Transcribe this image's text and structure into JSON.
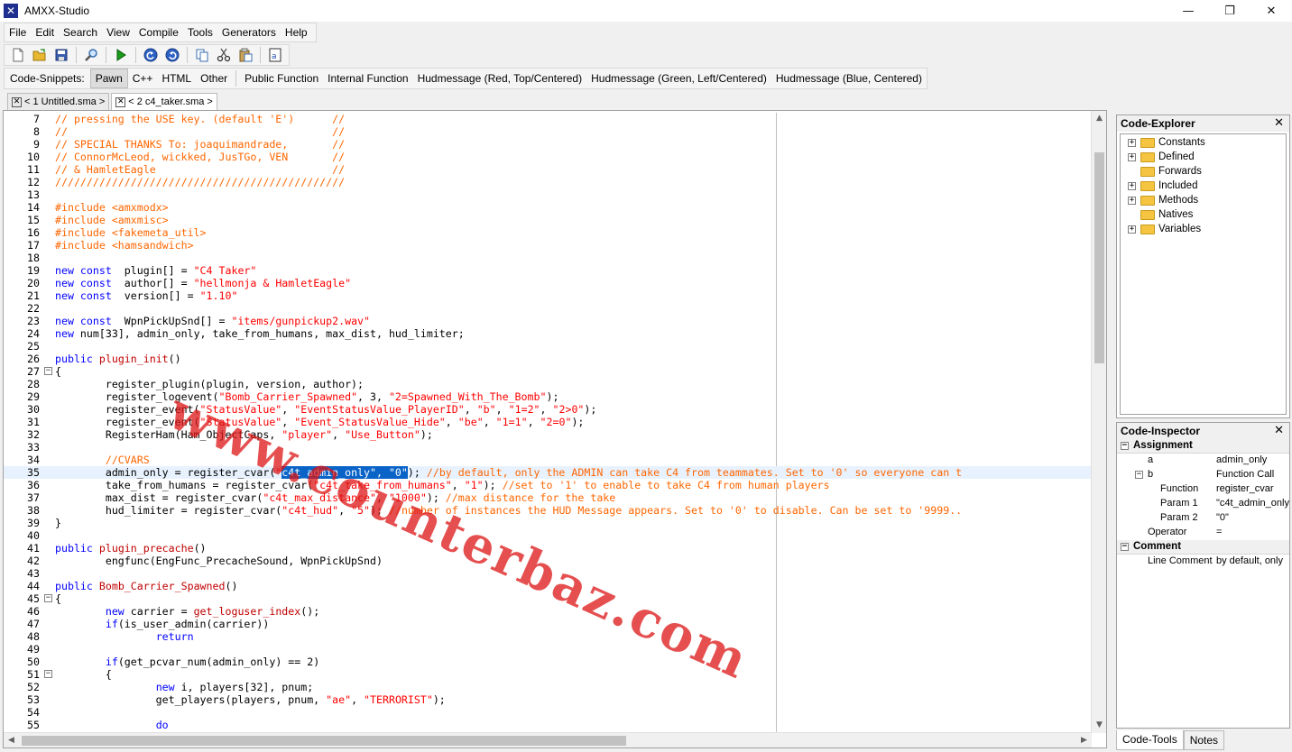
{
  "window": {
    "title": "AMXX-Studio"
  },
  "menu": [
    "File",
    "Edit",
    "Search",
    "View",
    "Compile",
    "Tools",
    "Generators",
    "Help"
  ],
  "toolbar_icons": [
    "new-file-icon",
    "open-folder-icon",
    "save-icon",
    "search-icon",
    "compile-run-icon",
    "undo-icon",
    "redo-icon",
    "copy-icon",
    "cut-icon",
    "paste-icon",
    "select-all-icon"
  ],
  "snippets": {
    "label": "Code-Snippets:",
    "items": [
      "Pawn",
      "C++",
      "HTML",
      "Other",
      "Public Function",
      "Internal Function",
      "Hudmessage (Red, Top/Centered)",
      "Hudmessage (Green, Left/Centered)",
      "Hudmessage (Blue, Centered)"
    ],
    "active": "Pawn"
  },
  "tabs": [
    {
      "label": "< 1 Untitled.sma >",
      "active": false
    },
    {
      "label": "< 2 c4_taker.sma >",
      "active": true
    }
  ],
  "watermark": "www.counterbaz.com",
  "code_lines": [
    {
      "n": "7",
      "fold": "",
      "tokens": [
        [
          "cm",
          "// pressing the USE key. (default 'E')      //"
        ]
      ]
    },
    {
      "n": "8",
      "fold": "",
      "tokens": [
        [
          "cm",
          "//                                          //"
        ]
      ]
    },
    {
      "n": "9",
      "fold": "",
      "tokens": [
        [
          "cm",
          "// SPECIAL THANKS To: joaquimandrade,       //"
        ]
      ]
    },
    {
      "n": "10",
      "fold": "",
      "tokens": [
        [
          "cm",
          "// ConnorMcLeod, wickked, JusTGo, VEN       //"
        ]
      ]
    },
    {
      "n": "11",
      "fold": "",
      "tokens": [
        [
          "cm",
          "// & HamletEagle                            //"
        ]
      ]
    },
    {
      "n": "12",
      "fold": "",
      "tokens": [
        [
          "cm",
          "//////////////////////////////////////////////"
        ]
      ]
    },
    {
      "n": "13",
      "fold": "",
      "tokens": []
    },
    {
      "n": "14",
      "fold": "",
      "tokens": [
        [
          "pp",
          "#include <amxmodx>"
        ]
      ]
    },
    {
      "n": "15",
      "fold": "",
      "tokens": [
        [
          "pp",
          "#include <amxmisc>"
        ]
      ]
    },
    {
      "n": "16",
      "fold": "",
      "tokens": [
        [
          "pp",
          "#include <fakemeta_util>"
        ]
      ]
    },
    {
      "n": "17",
      "fold": "",
      "tokens": [
        [
          "pp",
          "#include <hamsandwich>"
        ]
      ]
    },
    {
      "n": "18",
      "fold": "",
      "tokens": []
    },
    {
      "n": "19",
      "fold": "",
      "tokens": [
        [
          "kw",
          "new const"
        ],
        [
          "",
          "  plugin[] = "
        ],
        [
          "st",
          "\"C4 Taker\""
        ]
      ]
    },
    {
      "n": "20",
      "fold": "",
      "tokens": [
        [
          "kw",
          "new const"
        ],
        [
          "",
          "  author[] = "
        ],
        [
          "st",
          "\"hellmonja & HamletEagle\""
        ]
      ]
    },
    {
      "n": "21",
      "fold": "",
      "tokens": [
        [
          "kw",
          "new const"
        ],
        [
          "",
          "  version[] = "
        ],
        [
          "st",
          "\"1.10\""
        ]
      ]
    },
    {
      "n": "22",
      "fold": "",
      "tokens": []
    },
    {
      "n": "23",
      "fold": "",
      "tokens": [
        [
          "kw",
          "new const"
        ],
        [
          "",
          "  WpnPickUpSnd[] = "
        ],
        [
          "st",
          "\"items/gunpickup2.wav\""
        ]
      ]
    },
    {
      "n": "24",
      "fold": "",
      "tokens": [
        [
          "kw",
          "new"
        ],
        [
          "",
          " num[33], admin_only, take_from_humans, max_dist, hud_limiter;"
        ]
      ]
    },
    {
      "n": "25",
      "fold": "",
      "tokens": []
    },
    {
      "n": "26",
      "fold": "",
      "tokens": [
        [
          "kw",
          "public"
        ],
        [
          "",
          " "
        ],
        [
          "fn",
          "plugin_init"
        ],
        [
          "",
          "()"
        ]
      ]
    },
    {
      "n": "27",
      "fold": "-",
      "tokens": [
        [
          "",
          "{"
        ]
      ]
    },
    {
      "n": "28",
      "fold": "",
      "tokens": [
        [
          "",
          "        register_plugin(plugin, version, author);"
        ]
      ]
    },
    {
      "n": "29",
      "fold": "",
      "tokens": [
        [
          "",
          "        register_logevent("
        ],
        [
          "st",
          "\"Bomb_Carrier_Spawned\""
        ],
        [
          "",
          ", 3, "
        ],
        [
          "st",
          "\"2=Spawned_With_The_Bomb\""
        ],
        [
          "",
          ");"
        ]
      ]
    },
    {
      "n": "30",
      "fold": "",
      "tokens": [
        [
          "",
          "        register_event("
        ],
        [
          "st",
          "\"StatusValue\""
        ],
        [
          "",
          ", "
        ],
        [
          "st",
          "\"EventStatusValue_PlayerID\""
        ],
        [
          "",
          ", "
        ],
        [
          "st",
          "\"b\""
        ],
        [
          "",
          ", "
        ],
        [
          "st",
          "\"1=2\""
        ],
        [
          "",
          ", "
        ],
        [
          "st",
          "\"2>0\""
        ],
        [
          "",
          ");"
        ]
      ]
    },
    {
      "n": "31",
      "fold": "",
      "tokens": [
        [
          "",
          "        register_event("
        ],
        [
          "st",
          "\"StatusValue\""
        ],
        [
          "",
          ", "
        ],
        [
          "st",
          "\"Event_StatusValue_Hide\""
        ],
        [
          "",
          ", "
        ],
        [
          "st",
          "\"be\""
        ],
        [
          "",
          ", "
        ],
        [
          "st",
          "\"1=1\""
        ],
        [
          "",
          ", "
        ],
        [
          "st",
          "\"2=0\""
        ],
        [
          "",
          ");"
        ]
      ]
    },
    {
      "n": "32",
      "fold": "",
      "tokens": [
        [
          "",
          "        RegisterHam(Ham_ObjectCaps, "
        ],
        [
          "st",
          "\"player\""
        ],
        [
          "",
          ", "
        ],
        [
          "st",
          "\"Use_Button\""
        ],
        [
          "",
          ");"
        ]
      ]
    },
    {
      "n": "33",
      "fold": "",
      "tokens": []
    },
    {
      "n": "34",
      "fold": "",
      "tokens": [
        [
          "cm",
          "        //CVARS"
        ]
      ]
    },
    {
      "n": "35",
      "fold": "",
      "current": true,
      "tokens": [
        [
          "",
          "        admin_only = register_cvar("
        ],
        [
          "st",
          "\""
        ],
        [
          "sel",
          "c4t_admin_only\", \"0\""
        ],
        [
          "",
          ");"
        ],
        [
          "cm",
          " //by default, only the ADMIN can take C4 from teammates. Set to '0' so everyone can t"
        ]
      ]
    },
    {
      "n": "36",
      "fold": "",
      "tokens": [
        [
          "",
          "        take_from_humans = register_cvar("
        ],
        [
          "st",
          "\"c4t_take_from_humans\""
        ],
        [
          "",
          ", "
        ],
        [
          "st",
          "\"1\""
        ],
        [
          "",
          ");"
        ],
        [
          "cm",
          " //set to '1' to enable to take C4 from human players"
        ]
      ]
    },
    {
      "n": "37",
      "fold": "",
      "tokens": [
        [
          "",
          "        max_dist = register_cvar("
        ],
        [
          "st",
          "\"c4t_max_distance\""
        ],
        [
          "",
          ", "
        ],
        [
          "st",
          "\"1000\""
        ],
        [
          "",
          ");"
        ],
        [
          "cm",
          " //max distance for the take"
        ]
      ]
    },
    {
      "n": "38",
      "fold": "",
      "tokens": [
        [
          "",
          "        hud_limiter = register_cvar("
        ],
        [
          "st",
          "\"c4t_hud\""
        ],
        [
          "",
          ", "
        ],
        [
          "st",
          "\"5\""
        ],
        [
          "",
          ");"
        ],
        [
          "cm",
          " //number of instances the HUD Message appears. Set to '0' to disable. Can be set to '9999.."
        ]
      ]
    },
    {
      "n": "39",
      "fold": "",
      "tokens": [
        [
          "",
          "}"
        ]
      ]
    },
    {
      "n": "40",
      "fold": "",
      "tokens": []
    },
    {
      "n": "41",
      "fold": "",
      "tokens": [
        [
          "kw",
          "public"
        ],
        [
          "",
          " "
        ],
        [
          "fn",
          "plugin_precache"
        ],
        [
          "",
          "()"
        ]
      ]
    },
    {
      "n": "42",
      "fold": "",
      "tokens": [
        [
          "",
          "        engfunc(EngFunc_PrecacheSound, WpnPickUpSnd)"
        ]
      ]
    },
    {
      "n": "43",
      "fold": "",
      "tokens": []
    },
    {
      "n": "44",
      "fold": "",
      "tokens": [
        [
          "kw",
          "public"
        ],
        [
          "",
          " "
        ],
        [
          "fn",
          "Bomb_Carrier_Spawned"
        ],
        [
          "",
          "()"
        ]
      ]
    },
    {
      "n": "45",
      "fold": "-",
      "tokens": [
        [
          "",
          "{"
        ]
      ]
    },
    {
      "n": "46",
      "fold": "",
      "tokens": [
        [
          "",
          "        "
        ],
        [
          "kw",
          "new"
        ],
        [
          "",
          " carrier = "
        ],
        [
          "fn",
          "get_loguser_index"
        ],
        [
          "",
          "();"
        ]
      ]
    },
    {
      "n": "47",
      "fold": "",
      "tokens": [
        [
          "",
          "        "
        ],
        [
          "kw",
          "if"
        ],
        [
          "",
          "(is_user_admin(carrier))"
        ]
      ]
    },
    {
      "n": "48",
      "fold": "",
      "tokens": [
        [
          "",
          "                "
        ],
        [
          "kw",
          "return"
        ]
      ]
    },
    {
      "n": "49",
      "fold": "",
      "tokens": []
    },
    {
      "n": "50",
      "fold": "",
      "tokens": [
        [
          "",
          "        "
        ],
        [
          "kw",
          "if"
        ],
        [
          "",
          "(get_pcvar_num(admin_only) == 2)"
        ]
      ]
    },
    {
      "n": "51",
      "fold": "-",
      "tokens": [
        [
          "",
          "        {"
        ]
      ]
    },
    {
      "n": "52",
      "fold": "",
      "tokens": [
        [
          "",
          "                "
        ],
        [
          "kw",
          "new"
        ],
        [
          "",
          " i, players[32], pnum;"
        ]
      ]
    },
    {
      "n": "53",
      "fold": "",
      "tokens": [
        [
          "",
          "                get_players(players, pnum, "
        ],
        [
          "st",
          "\"ae\""
        ],
        [
          "",
          ", "
        ],
        [
          "st",
          "\"TERRORIST\""
        ],
        [
          "",
          ");"
        ]
      ]
    },
    {
      "n": "54",
      "fold": "",
      "tokens": []
    },
    {
      "n": "55",
      "fold": "",
      "tokens": [
        [
          "",
          "                "
        ],
        [
          "kw",
          "do"
        ]
      ]
    }
  ],
  "explorer": {
    "title": "Code-Explorer",
    "items": [
      {
        "label": "Constants",
        "expandable": true
      },
      {
        "label": "Defined",
        "expandable": true
      },
      {
        "label": "Forwards",
        "expandable": false
      },
      {
        "label": "Included",
        "expandable": true
      },
      {
        "label": "Methods",
        "expandable": true
      },
      {
        "label": "Natives",
        "expandable": false
      },
      {
        "label": "Variables",
        "expandable": true
      }
    ]
  },
  "inspector": {
    "title": "Code-Inspector",
    "groups": {
      "assignment": "Assignment",
      "comment": "Comment"
    },
    "rows": {
      "a_key": "a",
      "a_val": "admin_only",
      "b_key": "b",
      "b_val": "Function Call",
      "fn_key": "Function",
      "fn_val": "register_cvar",
      "p1_key": "Param 1",
      "p1_val": "\"c4t_admin_only",
      "p2_key": "Param 2",
      "p2_val": "\"0\"",
      "op_key": "Operator",
      "op_val": "=",
      "lc_key": "Line Comment",
      "lc_val": "by default, only"
    }
  },
  "bottom_tabs": [
    "Code-Tools",
    "Notes"
  ],
  "colors": {
    "comment": "#ff6600",
    "keyword": "#0000ff",
    "string": "#ff0000",
    "function": "#c00000",
    "selection": "#0a64c8",
    "current_line": "#e8f2fe",
    "watermark": "#dc1414"
  }
}
